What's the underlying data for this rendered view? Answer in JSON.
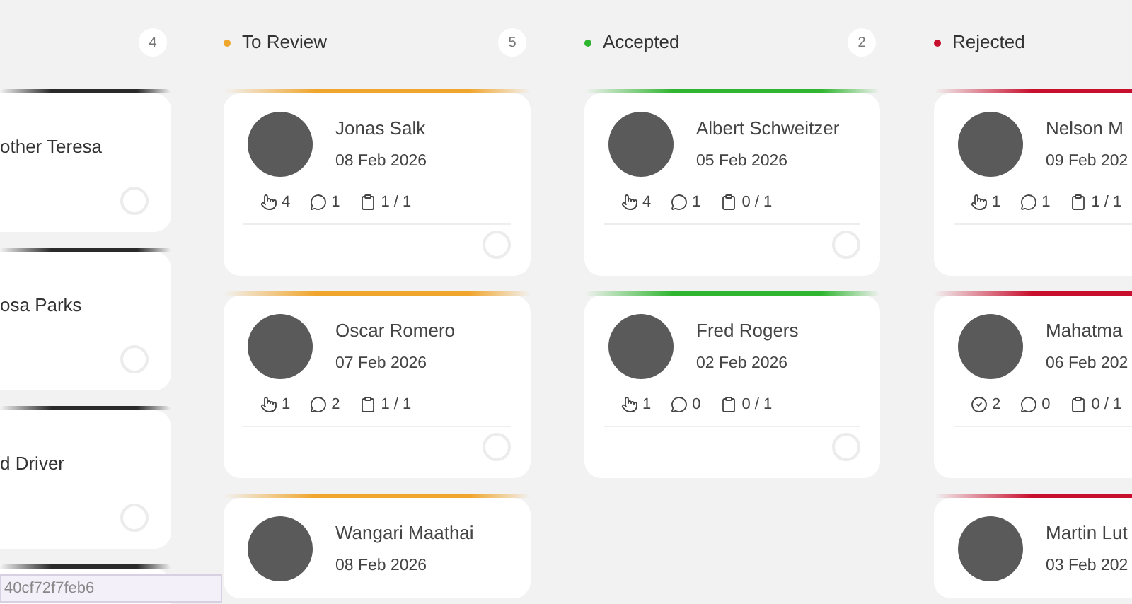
{
  "columns": [
    {
      "count": "4",
      "color": "#2a2a2a",
      "cards": [
        {
          "kind": "compact",
          "name": "other Teresa",
          "checked": false
        },
        {
          "kind": "compact",
          "name": "osa Parks",
          "checked": false
        },
        {
          "kind": "compact",
          "name": "d Driver",
          "checked": false
        },
        {
          "kind": "compact"
        }
      ]
    },
    {
      "title": "To Review",
      "count": "5",
      "color": "#f0a52c",
      "cards": [
        {
          "kind": "full",
          "name": "Jonas Salk",
          "date": "08 Feb 2026",
          "checked": false,
          "stats": [
            {
              "kind": "hand",
              "value": "4"
            },
            {
              "kind": "comment",
              "value": "1"
            },
            {
              "kind": "clipboard",
              "value": "1 / 1"
            }
          ]
        },
        {
          "kind": "full",
          "name": "Oscar Romero",
          "date": "07 Feb 2026",
          "checked": false,
          "stats": [
            {
              "kind": "hand",
              "value": "1"
            },
            {
              "kind": "comment",
              "value": "2"
            },
            {
              "kind": "clipboard",
              "value": "1 / 1"
            }
          ]
        },
        {
          "kind": "full",
          "name": "Wangari Maathai",
          "date": "08 Feb 2026"
        }
      ]
    },
    {
      "title": "Accepted",
      "count": "2",
      "color": "#2fb52f",
      "cards": [
        {
          "kind": "full",
          "name": "Albert Schweitzer",
          "date": "05 Feb 2026",
          "checked": false,
          "stats": [
            {
              "kind": "hand",
              "value": "4"
            },
            {
              "kind": "comment",
              "value": "1"
            },
            {
              "kind": "clipboard",
              "value": "0 / 1"
            }
          ]
        },
        {
          "kind": "full",
          "name": "Fred Rogers",
          "date": "02 Feb 2026",
          "checked": false,
          "stats": [
            {
              "kind": "hand",
              "value": "1"
            },
            {
              "kind": "comment",
              "value": "0"
            },
            {
              "kind": "clipboard",
              "value": "0 / 1"
            }
          ]
        }
      ]
    },
    {
      "title": "Rejected",
      "color": "#c8102e",
      "cards": [
        {
          "kind": "full",
          "name": "Nelson M",
          "date": "09 Feb 202",
          "stats": [
            {
              "kind": "hand",
              "value": "1"
            },
            {
              "kind": "comment",
              "value": "1"
            },
            {
              "kind": "clipboard",
              "value": "1 / 1"
            }
          ]
        },
        {
          "kind": "full",
          "name": "Mahatma",
          "date": "06 Feb 202",
          "stats": [
            {
              "kind": "check",
              "value": "2"
            },
            {
              "kind": "comment",
              "value": "0"
            },
            {
              "kind": "clipboard",
              "value": "0 / 1"
            }
          ]
        },
        {
          "kind": "full",
          "name": "Martin Lut",
          "date": "03 Feb 202"
        }
      ]
    }
  ],
  "link_preview": "40cf72f7feb6"
}
